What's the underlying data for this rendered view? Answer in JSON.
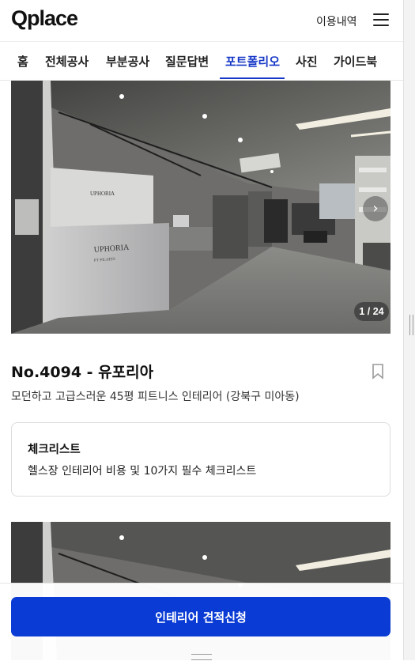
{
  "header": {
    "logo": "Qplace",
    "usage_link": "이용내역",
    "menu_icon": "hamburger-menu-icon"
  },
  "tabs": [
    {
      "label": "홈"
    },
    {
      "label": "전체공사"
    },
    {
      "label": "부분공사"
    },
    {
      "label": "질문답변"
    },
    {
      "label": "포트폴리오",
      "active": true
    },
    {
      "label": "사진"
    },
    {
      "label": "가이드북"
    }
  ],
  "gallery": {
    "counter": "1 / 24",
    "next_icon": "chevron-right-icon",
    "sign_text": "UPHORIA",
    "sign_sub": "PT·PILATES"
  },
  "portfolio": {
    "title": "No.4094 - 유포리아",
    "subtitle": "모던하고 고급스러운 45평 피트니스 인테리어 (강북구 미아동)",
    "bookmark_icon": "bookmark-icon"
  },
  "checklist": {
    "title": "체크리스트",
    "text": "헬스장 인테리어 비용 및 10가지 필수 체크리스트"
  },
  "cta": {
    "label": "인테리어 견적신청"
  },
  "colors": {
    "accent": "#1537c7",
    "cta_bg": "#0a3bd4"
  }
}
